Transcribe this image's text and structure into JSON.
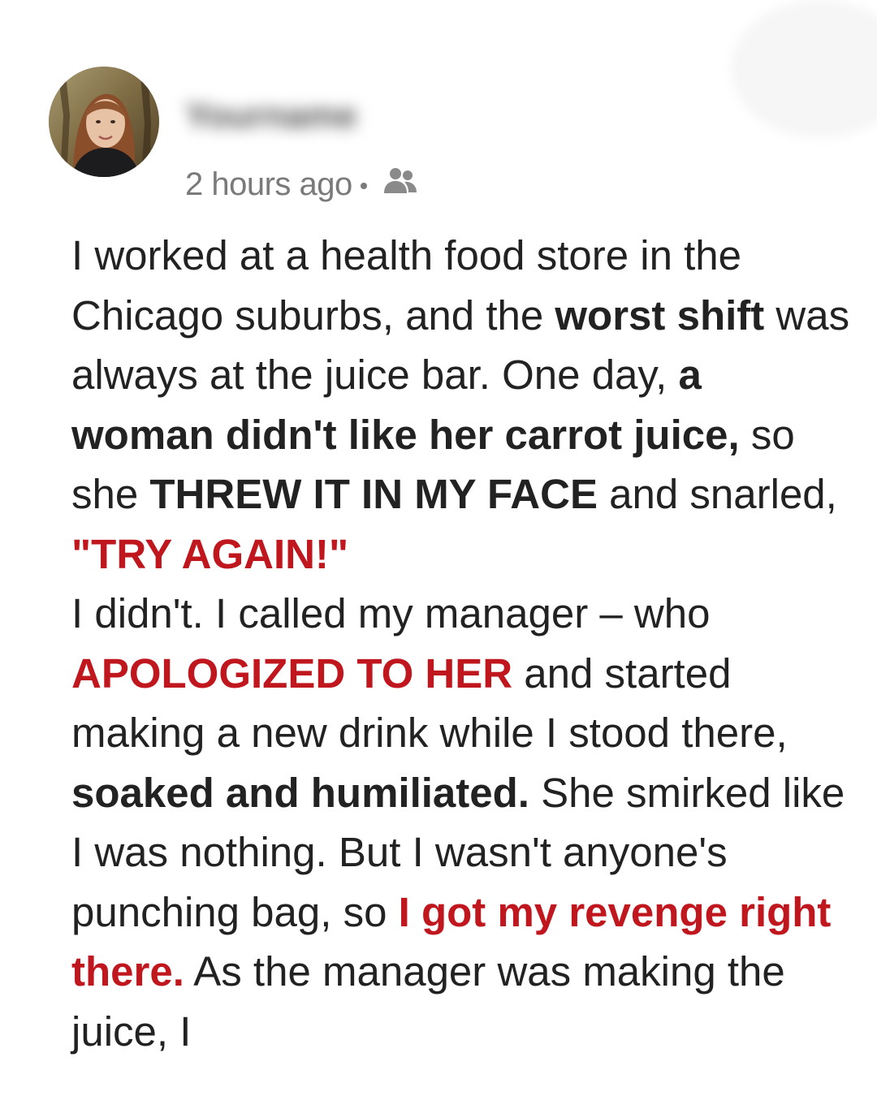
{
  "post": {
    "author": {
      "name": "Yourname",
      "name_blurred": true
    },
    "timestamp": "2 hours ago",
    "audience_icon": "friends-icon",
    "body": [
      {
        "text": "I worked at a health food store in the Chicago suburbs, and the ",
        "style": "normal"
      },
      {
        "text": "worst shift",
        "style": "bold"
      },
      {
        "text": " was always at the juice bar. One day, ",
        "style": "normal"
      },
      {
        "text": "a woman didn't like her carrot juice,",
        "style": "bold"
      },
      {
        "text": " so she ",
        "style": "normal"
      },
      {
        "text": "THREW IT IN MY FACE",
        "style": "bold"
      },
      {
        "text": " and snarled, ",
        "style": "normal"
      },
      {
        "text": "\"TRY AGAIN!\"",
        "style": "red"
      },
      {
        "text": "I didn't. I called my manager – who ",
        "style": "normal"
      },
      {
        "text": "APOLOGIZED TO HER",
        "style": "red"
      },
      {
        "text": " and started making a new drink while I stood there, ",
        "style": "normal"
      },
      {
        "text": "soaked and humiliated.",
        "style": "bold"
      },
      {
        "text": " She smirked like I was nothing. But I wasn't anyone's punching bag, so ",
        "style": "normal"
      },
      {
        "text": "I got my revenge right there.",
        "style": "red"
      },
      {
        "text": " As the manager was making the juice, I",
        "style": "normal"
      }
    ]
  },
  "colors": {
    "text": "#222222",
    "meta": "#7a7a7a",
    "accent_red": "#c0171e",
    "background": "#ffffff"
  }
}
